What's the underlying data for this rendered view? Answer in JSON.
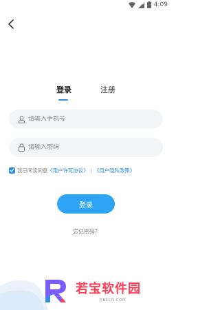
{
  "status_bar": {
    "time": "4:09"
  },
  "tabs": [
    {
      "label": "登录",
      "active": true
    },
    {
      "label": "注册",
      "active": false
    }
  ],
  "phone_field": {
    "placeholder": "请输入手机号",
    "icon": "user-icon"
  },
  "password_field": {
    "placeholder": "请输入密码",
    "icon": "lock-icon"
  },
  "agreement": {
    "checked": true,
    "prefix": "我已阅读同意",
    "user_license": "《用户许可协议》",
    "separator": "|",
    "privacy_policy": "《用户隐私政策》"
  },
  "login_button": "登录",
  "forgot_password": "忘记密码?",
  "watermark": {
    "brand": "若宝软件园",
    "url": "RBSCN.COM"
  },
  "colors": {
    "accent": "#2fa4f5",
    "link": "#2f8fe0",
    "watermark": "#ff3e55"
  }
}
